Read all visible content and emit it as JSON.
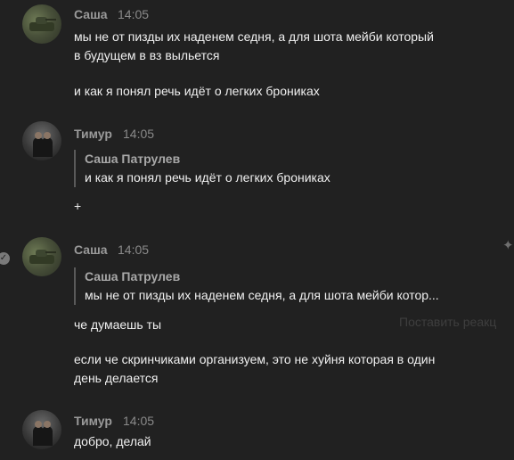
{
  "messages": [
    {
      "author": "Саша",
      "time": "14:05",
      "lines": [
        "мы не от пизды их наденем седня, а для шота мейби который",
        "в будущем в вз выльется",
        "и как я понял речь идёт о легких брониках"
      ]
    },
    {
      "author": "Тимур",
      "time": "14:05",
      "quote": {
        "author": "Саша Патрулев",
        "text": "и как я понял речь идёт о легких брониках"
      },
      "lines": [
        "+"
      ]
    },
    {
      "author": "Саша",
      "time": "14:05",
      "quote": {
        "author": "Саша Патрулев",
        "text": "мы не от пизды их наденем седня, а для шота мейби котор..."
      },
      "lines": [
        "че думаешь ты",
        "если че скринчиками организуем, это не хуйня которая в один",
        "день делается"
      ]
    },
    {
      "author": "Тимур",
      "time": "14:05",
      "lines": [
        "добро, делай"
      ]
    }
  ],
  "ghost_action": "Поставить реакц",
  "icons": {
    "check": "check-circle-icon",
    "sparkle": "sparkle-icon"
  },
  "colors": {
    "background": "#212121",
    "name": "#9a9a9a",
    "text": "#f0f0f0"
  }
}
